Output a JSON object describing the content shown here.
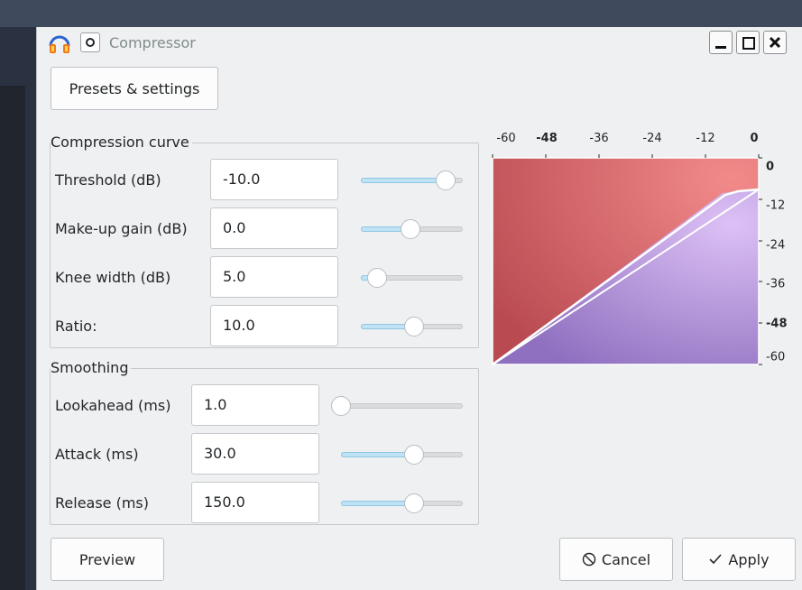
{
  "window": {
    "title": "Compressor"
  },
  "toolbar": {
    "presets_label": "Presets & settings"
  },
  "compression_curve": {
    "title": "Compression curve",
    "rows": [
      {
        "label": "Threshold (dB)",
        "value": "-10.0",
        "slider_fraction": 0.83
      },
      {
        "label": "Make-up gain (dB)",
        "value": "0.0",
        "slider_fraction": 0.49
      },
      {
        "label": "Knee width (dB)",
        "value": "5.0",
        "slider_fraction": 0.16
      },
      {
        "label": "Ratio:",
        "value": "10.0",
        "slider_fraction": 0.52
      }
    ]
  },
  "smoothing": {
    "title": "Smoothing",
    "rows": [
      {
        "label": "Lookahead (ms)",
        "value": "1.0",
        "slider_fraction": 0.04
      },
      {
        "label": "Attack (ms)",
        "value": "30.0",
        "slider_fraction": 0.6
      },
      {
        "label": "Release (ms)",
        "value": "150.0",
        "slider_fraction": 0.6
      }
    ]
  },
  "graph": {
    "x_ticks": [
      "-60",
      "-48",
      "-36",
      "-24",
      "-12",
      "0"
    ],
    "y_ticks": [
      "0",
      "-12",
      "-24",
      "-36",
      "-48",
      "-60"
    ],
    "bold_ticks": [
      "-48",
      "0"
    ]
  },
  "footer": {
    "preview_label": "Preview",
    "cancel_label": "Cancel",
    "apply_label": "Apply"
  },
  "icons": {
    "app": "headphones-icon",
    "pin": "pin-icon",
    "minimize": "minimize-icon",
    "maximize": "maximize-icon",
    "close": "close-icon",
    "cancel": "no-entry-icon",
    "apply": "checkmark-icon"
  }
}
